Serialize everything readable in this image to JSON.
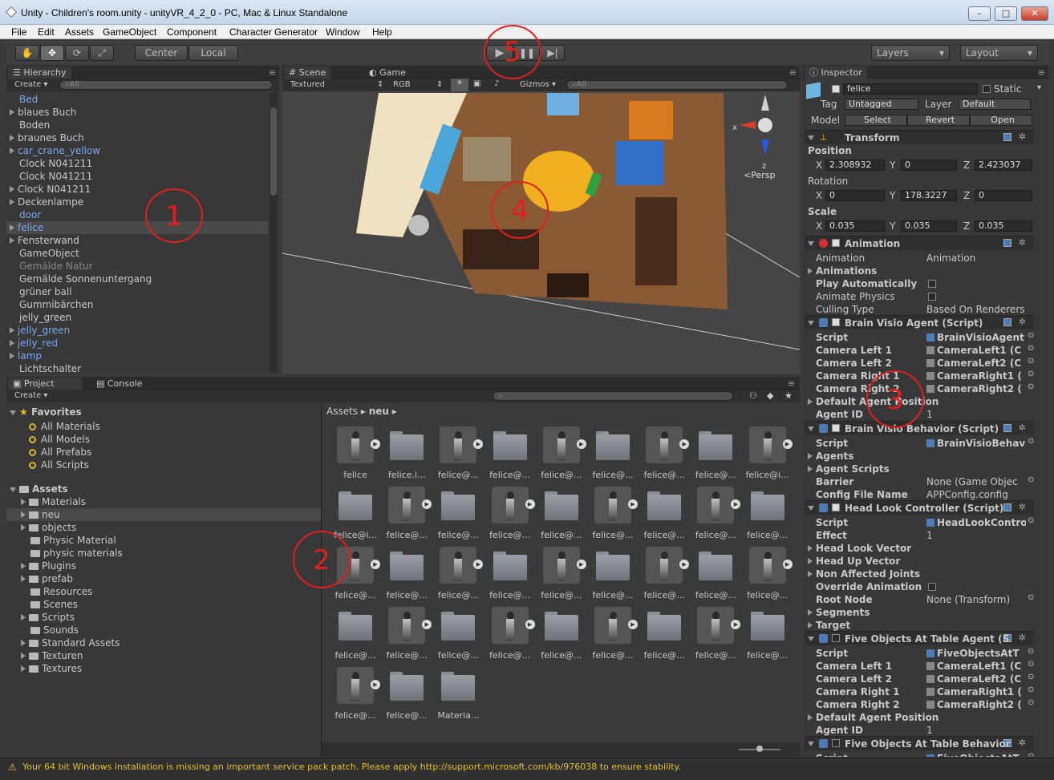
{
  "window": {
    "title": "Unity - Children's room.unity - unityVR_4_2_0 - PC, Mac & Linux Standalone"
  },
  "menu": [
    "File",
    "Edit",
    "Assets",
    "GameObject",
    "Component",
    "Character Generator",
    "Window",
    "Help"
  ],
  "toolbar": {
    "center_label": "Center",
    "local_label": "Local",
    "layers_label": "Layers",
    "layout_label": "Layout"
  },
  "hierarchy": {
    "tab": "Hierarchy",
    "create": "Create",
    "search_placeholder": "All",
    "items": [
      {
        "label": "Bed"
      },
      {
        "label": "blaues Buch"
      },
      {
        "label": "Boden"
      },
      {
        "label": "braunes Buch"
      },
      {
        "label": "car_crane_yellow"
      },
      {
        "label": "Clock N041211"
      },
      {
        "label": "Clock N041211"
      },
      {
        "label": "Clock N041211"
      },
      {
        "label": "Deckenlampe"
      },
      {
        "label": "door"
      },
      {
        "label": "felice"
      },
      {
        "label": "Fensterwand"
      },
      {
        "label": "GameObject"
      },
      {
        "label": "Gemälde Natur"
      },
      {
        "label": "Gemälde Sonnenuntergang"
      },
      {
        "label": "grüner ball"
      },
      {
        "label": "Gummibärchen"
      },
      {
        "label": "jelly_green"
      },
      {
        "label": "jelly_green"
      },
      {
        "label": "jelly_red"
      },
      {
        "label": "lamp"
      },
      {
        "label": "Lichtschalter"
      }
    ]
  },
  "scene": {
    "tab": "Scene",
    "game_tab": "Game",
    "shading": "Textured",
    "rendermode": "RGB",
    "gizmos": "Gizmos",
    "search_placeholder": "All",
    "persp": "Persp",
    "axis_x": "x",
    "axis_z": "z"
  },
  "project": {
    "tab": "Project",
    "console_tab": "Console",
    "create": "Create",
    "favorites_label": "Favorites",
    "favorites": [
      "All Materials",
      "All Models",
      "All Prefabs",
      "All Scripts"
    ],
    "assets_label": "Assets",
    "folders": [
      "Materials",
      "neu",
      "objects",
      "Physic Material",
      "physic materials",
      "Plugins",
      "prefab",
      "Resources",
      "Scenes",
      "Scripts",
      "Sounds",
      "Standard Assets",
      "Texturen",
      "Textures"
    ],
    "breadcrumb": [
      "Assets",
      "neu"
    ],
    "grid": [
      {
        "label": "felice",
        "kind": "model"
      },
      {
        "label": "felice.i...",
        "kind": "folder"
      },
      {
        "label": "felice@...",
        "kind": "model"
      },
      {
        "label": "felice@...",
        "kind": "folder"
      },
      {
        "label": "felice@...",
        "kind": "model"
      },
      {
        "label": "felice@...",
        "kind": "folder"
      },
      {
        "label": "felice@...",
        "kind": "model"
      },
      {
        "label": "felice@...",
        "kind": "folder"
      },
      {
        "label": "felice@i...",
        "kind": "model"
      },
      {
        "label": "felice@i...",
        "kind": "folder"
      },
      {
        "label": "felice@...",
        "kind": "model"
      },
      {
        "label": "felice@...",
        "kind": "folder"
      },
      {
        "label": "felice@...",
        "kind": "model"
      },
      {
        "label": "felice@...",
        "kind": "folder"
      },
      {
        "label": "felice@...",
        "kind": "model"
      },
      {
        "label": "felice@...",
        "kind": "folder"
      },
      {
        "label": "felice@...",
        "kind": "model"
      },
      {
        "label": "felice@...",
        "kind": "folder"
      },
      {
        "label": "felice@...",
        "kind": "model"
      },
      {
        "label": "felice@...",
        "kind": "folder"
      },
      {
        "label": "felice@...",
        "kind": "model"
      },
      {
        "label": "felice@...",
        "kind": "folder"
      },
      {
        "label": "felice@...",
        "kind": "model"
      },
      {
        "label": "felice@...",
        "kind": "folder"
      },
      {
        "label": "felice@...",
        "kind": "model"
      },
      {
        "label": "felice@...",
        "kind": "folder"
      },
      {
        "label": "felice@...",
        "kind": "model"
      },
      {
        "label": "felice@...",
        "kind": "folder"
      },
      {
        "label": "felice@...",
        "kind": "model"
      },
      {
        "label": "felice@...",
        "kind": "folder"
      },
      {
        "label": "felice@...",
        "kind": "model"
      },
      {
        "label": "felice@...",
        "kind": "folder"
      },
      {
        "label": "felice@...",
        "kind": "model"
      },
      {
        "label": "felice@...",
        "kind": "folder"
      },
      {
        "label": "felice@...",
        "kind": "model"
      },
      {
        "label": "felice@...",
        "kind": "folder"
      },
      {
        "label": "felice@...",
        "kind": "model"
      },
      {
        "label": "felice@...",
        "kind": "folder"
      },
      {
        "label": "Materia...",
        "kind": "folder"
      }
    ]
  },
  "inspector": {
    "tab": "Inspector",
    "object_name": "felice",
    "static_label": "Static",
    "tag_label": "Tag",
    "tag_value": "Untagged",
    "layer_label": "Layer",
    "layer_value": "Default",
    "model_label": "Model",
    "select_btn": "Select",
    "revert_btn": "Revert",
    "open_btn": "Open",
    "transform": {
      "title": "Transform",
      "position_label": "Position",
      "rotation_label": "Rotation",
      "scale_label": "Scale",
      "position": [
        "2.308932",
        "0",
        "2.423037"
      ],
      "rotation": [
        "0",
        "178.3227",
        "0"
      ],
      "scale": [
        "0.035",
        "0.035",
        "0.035"
      ]
    },
    "animation": {
      "title": "Animation",
      "rows": [
        [
          "Animation",
          "Animation"
        ],
        [
          "Animations",
          ""
        ],
        [
          "Play Automatically",
          ""
        ],
        [
          "Animate Physics",
          ""
        ],
        [
          "Culling Type",
          "Based On Renderers"
        ]
      ]
    },
    "brain_agent": {
      "title": "Brain Visio Agent (Script)",
      "rows": [
        [
          "Script",
          "BrainVisioAgent"
        ],
        [
          "Camera Left 1",
          "CameraLeft1 (C"
        ],
        [
          "Camera Left 2",
          "CameraLeft2 (C"
        ],
        [
          "Camera Right 1",
          "CameraRight1 ("
        ],
        [
          "Camera Right 2",
          "CameraRight2 ("
        ],
        [
          "Default Agent Position",
          ""
        ],
        [
          "Agent ID",
          "1"
        ]
      ]
    },
    "brain_behavior": {
      "title": "Brain Visio Behavior (Script)",
      "rows": [
        [
          "Script",
          "BrainVisioBehav"
        ],
        [
          "Agents",
          ""
        ],
        [
          "Agent Scripts",
          ""
        ],
        [
          "Barrier",
          "None (Game Objec"
        ],
        [
          "Config File Name",
          "APPConfig.config"
        ]
      ]
    },
    "headlook": {
      "title": "Head Look Controller (Script)",
      "rows": [
        [
          "Script",
          "HeadLookContro"
        ],
        [
          "Effect",
          "1"
        ],
        [
          "Head Look Vector",
          ""
        ],
        [
          "Head Up Vector",
          ""
        ],
        [
          "Non Affected Joints",
          ""
        ],
        [
          "Override Animation",
          ""
        ],
        [
          "Root Node",
          "None (Transform)"
        ],
        [
          "Segments",
          ""
        ],
        [
          "Target",
          ""
        ]
      ]
    },
    "five_agent": {
      "title": "Five Objects At Table Agent (S",
      "rows": [
        [
          "Script",
          "FiveObjectsAtT"
        ],
        [
          "Camera Left 1",
          "CameraLeft1 (C"
        ],
        [
          "Camera Left 2",
          "CameraLeft2 (C"
        ],
        [
          "Camera Right 1",
          "CameraRight1 ("
        ],
        [
          "Camera Right 2",
          "CameraRight2 ("
        ],
        [
          "Default Agent Position",
          ""
        ],
        [
          "Agent ID",
          "1"
        ]
      ]
    },
    "five_behavior": {
      "title": "Five Objects At Table Behavior",
      "rows": [
        [
          "Script",
          "FiveObjectsAtT"
        ]
      ]
    }
  },
  "annotations": [
    "1",
    "2",
    "3",
    "4",
    "5"
  ],
  "status": {
    "message": "Your 64 bit Windows installation is missing an important service pack patch. Please apply http://support.microsoft.com/kb/976038 to ensure stability."
  }
}
